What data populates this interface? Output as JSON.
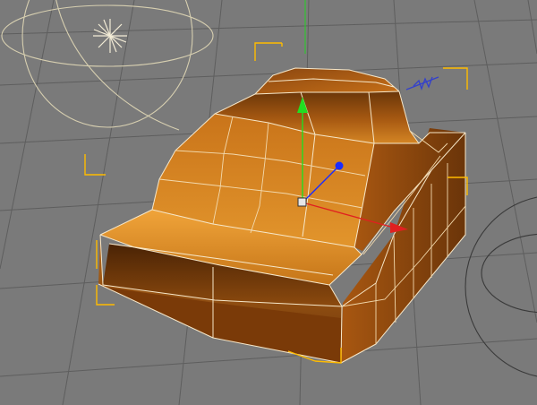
{
  "viewport": {
    "name": "3d-perspective-viewport",
    "background_color": "#7a7a7a",
    "grid_color": "#5e5e5e",
    "selection_bracket_color": "#ffbb00",
    "wireframe_color": "#f6e7c9"
  },
  "object": {
    "name": "car-body-mesh",
    "selected": true,
    "color_light": "#d6892c",
    "color_dark": "#5c2c06"
  },
  "gizmo": {
    "name": "move-gizmo",
    "axis_colors": {
      "x": "#e02020",
      "y": "#22dd22",
      "z": "#1a2cff"
    }
  },
  "icons": {
    "light": "light-source-icon",
    "camera": "camera-icon",
    "bend_deformer": "deformer-spring-icon"
  }
}
